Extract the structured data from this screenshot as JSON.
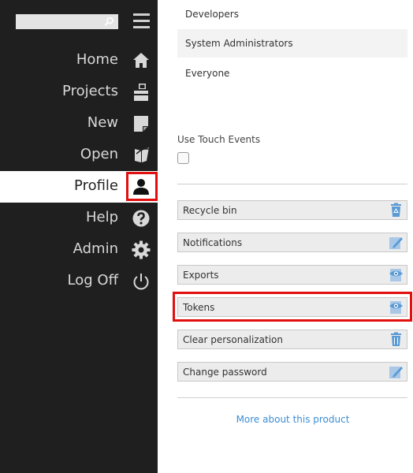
{
  "search": {
    "placeholder": "",
    "value": ""
  },
  "nav": {
    "items": [
      {
        "label": "Home",
        "icon": "home-icon"
      },
      {
        "label": "Projects",
        "icon": "projects-icon"
      },
      {
        "label": "New",
        "icon": "new-document-icon"
      },
      {
        "label": "Open",
        "icon": "open-folder-icon"
      },
      {
        "label": "Profile",
        "icon": "user-icon",
        "active": true
      },
      {
        "label": "Help",
        "icon": "help-icon"
      },
      {
        "label": "Admin",
        "icon": "gear-icon"
      },
      {
        "label": "Log Off",
        "icon": "power-icon"
      }
    ]
  },
  "groups": [
    "Developers",
    "System Administrators",
    "Everyone"
  ],
  "touch": {
    "label": "Use Touch Events",
    "checked": false
  },
  "actions": [
    {
      "label": "Recycle bin",
      "icon": "recycle-bin-icon"
    },
    {
      "label": "Notifications",
      "icon": "edit-icon"
    },
    {
      "label": "Exports",
      "icon": "view-icon"
    },
    {
      "label": "Tokens",
      "icon": "view-icon"
    },
    {
      "label": "Clear personalization",
      "icon": "trash-icon"
    },
    {
      "label": "Change password",
      "icon": "edit-icon"
    }
  ],
  "footer": {
    "more_link": "More about this product"
  },
  "colors": {
    "sidebar_bg": "#1f1f1f",
    "highlight": "#e20f0f",
    "link": "#3a8ed4"
  }
}
